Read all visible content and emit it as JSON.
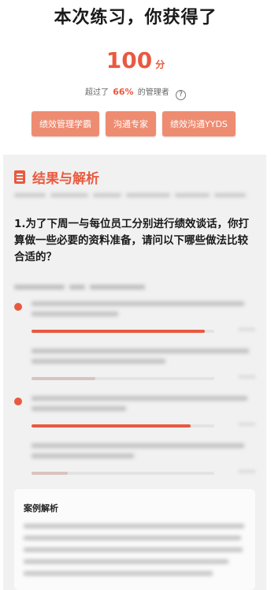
{
  "header": {
    "title": "本次练习，你获得了",
    "score": "100",
    "score_unit": "分",
    "percent_prefix": "超过了",
    "percent_value": "66%",
    "percent_suffix": "的管理者",
    "help_icon": "question-circle-icon"
  },
  "badges": [
    {
      "label": "绩效管理学霸"
    },
    {
      "label": "沟通专家"
    },
    {
      "label": "绩效沟通YYDS"
    }
  ],
  "analysis": {
    "section_title": "结果与解析",
    "section_icon": "document-icon",
    "question": "1.为了下周一与每位员工分别进行绩效谈话，你打算做一些必要的资料准备，请问以下哪些做法比较合适的？",
    "options": [
      {
        "selected": true,
        "percent": 0.95
      },
      {
        "selected": false,
        "percent": 0.35
      },
      {
        "selected": true,
        "percent": 0.87
      },
      {
        "selected": false,
        "percent": 0.2
      }
    ],
    "case_title": "案例解析"
  },
  "colors": {
    "accent": "#e85a40",
    "badge": "#ee8c72"
  }
}
